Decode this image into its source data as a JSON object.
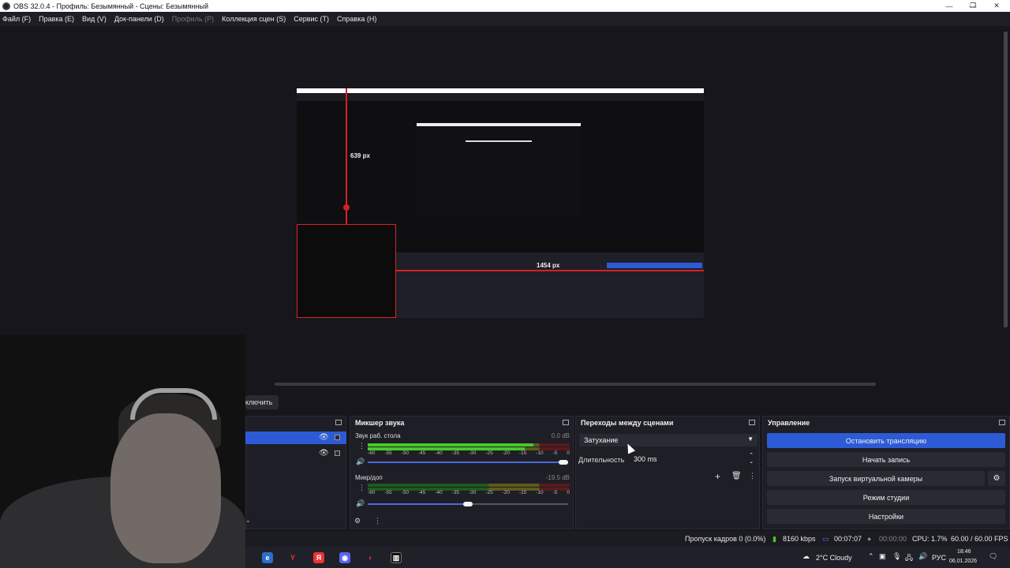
{
  "window": {
    "title": "OBS 32.0.4 - Профиль: Безымянный - Сцены: Безымянный",
    "controls": [
      "—",
      "❐",
      "✕"
    ]
  },
  "menu": {
    "items": [
      "Файл (F)",
      "Правка (E)",
      "Вид (V)",
      "Док-панели (D)",
      "Профиль (P)",
      "Коллекция сцен (S)",
      "Сервис (T)",
      "Справка (H)"
    ]
  },
  "preview": {
    "height_label": "639 px",
    "width_label": "1454 px"
  },
  "controls_row": {
    "stop_partial": "ключить"
  },
  "mixer": {
    "title": "Микшер звука",
    "channels": [
      {
        "name": "Звук раб. стола",
        "db": "0.0 dB",
        "level": 0.82,
        "volume": 1.0
      },
      {
        "name": "Микр/доп",
        "db": "-19.5 dB",
        "level": 0.0,
        "volume": 0.5
      }
    ],
    "ticks": [
      "-60",
      "-55",
      "-50",
      "-45",
      "-40",
      "-35",
      "-30",
      "-25",
      "-20",
      "-15",
      "-10",
      "-5",
      "0"
    ]
  },
  "transitions": {
    "title": "Переходы между сценами",
    "selected": "Затухание",
    "duration_label": "Длительность",
    "duration_value": "300 ms"
  },
  "controls": {
    "title": "Управление",
    "buttons": [
      "Остановить трансляцию",
      "Начать запись",
      "Запуск виртуальной камеры",
      "Режим студии",
      "Настройки"
    ]
  },
  "status": {
    "dropped": "Пропуск кадров 0 (0.0%)",
    "bitrate": "8160 kbps",
    "stream_time": "00:07:07",
    "rec_time": "00:00:00",
    "cpu": "CPU: 1.7%",
    "fps": "60.00 / 60.00 FPS"
  },
  "taskbar": {
    "weather": "2°C  Cloudy",
    "lang": "РУС",
    "time": "18:46",
    "date": "06.01.2026"
  },
  "colors": {
    "accent": "#2d5bd6",
    "meter_green": "#48c828",
    "guide_red": "#d71e28"
  }
}
